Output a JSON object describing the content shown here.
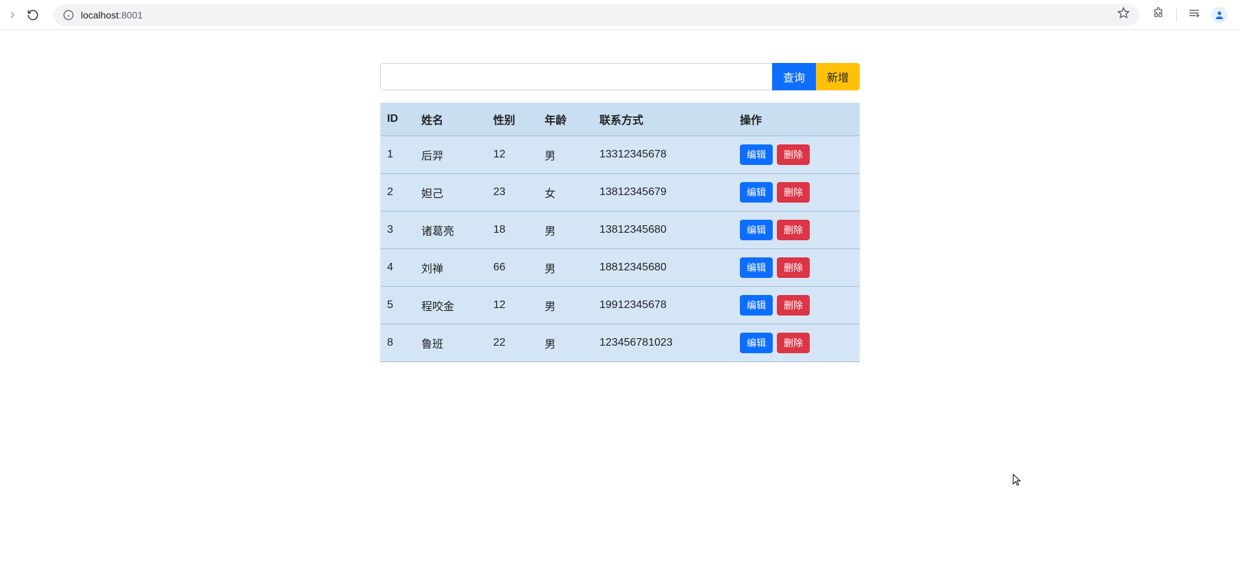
{
  "browser": {
    "url_host": "localhost",
    "url_path": ":8001"
  },
  "toolbar": {
    "search_value": "",
    "query_label": "查询",
    "add_label": "新增"
  },
  "table": {
    "headers": {
      "id": "ID",
      "name": "姓名",
      "gender": "性别",
      "age": "年龄",
      "contact": "联系方式",
      "actions": "操作"
    },
    "edit_label": "编辑",
    "delete_label": "删除",
    "rows": [
      {
        "id": "1",
        "name": "后羿",
        "gender": "12",
        "age": "男",
        "contact": "13312345678"
      },
      {
        "id": "2",
        "name": "妲己",
        "gender": "23",
        "age": "女",
        "contact": "13812345679"
      },
      {
        "id": "3",
        "name": "诸葛亮",
        "gender": "18",
        "age": "男",
        "contact": "13812345680"
      },
      {
        "id": "4",
        "name": "刘禅",
        "gender": "66",
        "age": "男",
        "contact": "18812345680"
      },
      {
        "id": "5",
        "name": "程咬金",
        "gender": "12",
        "age": "男",
        "contact": "19912345678"
      },
      {
        "id": "8",
        "name": "鲁班",
        "gender": "22",
        "age": "男",
        "contact": "123456781023"
      }
    ]
  }
}
